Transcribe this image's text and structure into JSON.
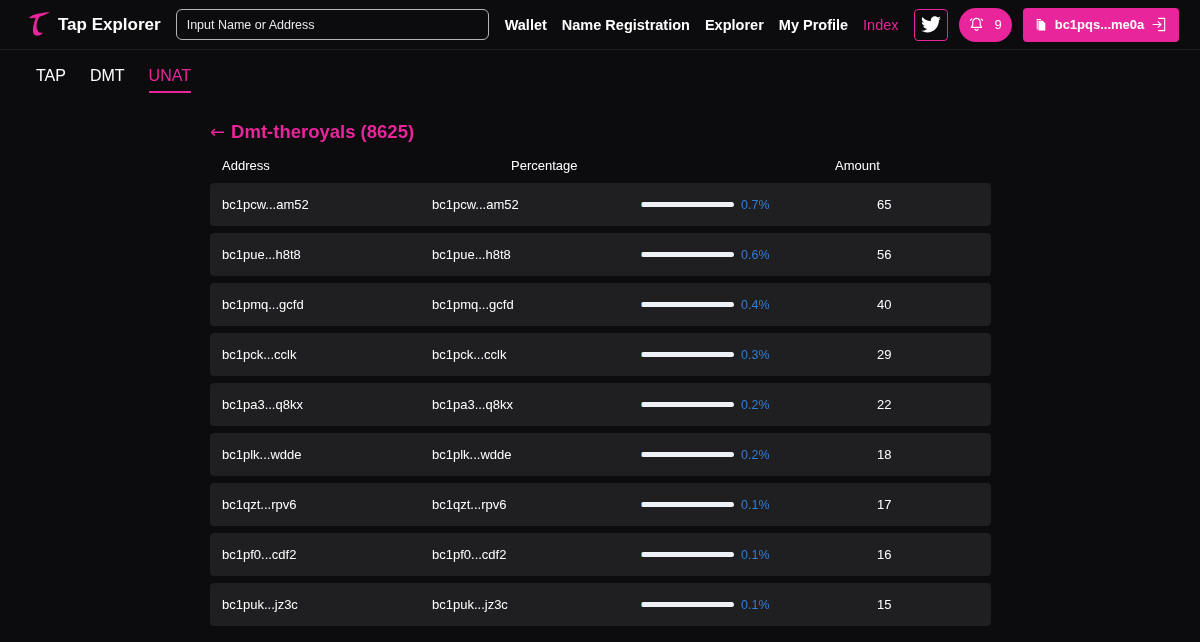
{
  "brand": {
    "name": "Tap Explorer"
  },
  "search": {
    "placeholder": "Input Name or Address"
  },
  "nav": [
    {
      "label": "Wallet",
      "selected": false
    },
    {
      "label": "Name Registration",
      "selected": false
    },
    {
      "label": "Explorer",
      "selected": false
    },
    {
      "label": "My Profile",
      "selected": false
    },
    {
      "label": "Index",
      "selected": true
    }
  ],
  "notifications": {
    "count": "9"
  },
  "wallet": {
    "address": "bc1pqs...me0a"
  },
  "tabs": [
    {
      "label": "TAP",
      "selected": false
    },
    {
      "label": "DMT",
      "selected": false
    },
    {
      "label": "UNAT",
      "selected": true
    }
  ],
  "page": {
    "back": "←",
    "title": "Dmt-theroyals (8625)"
  },
  "table": {
    "columns": [
      "Address",
      "Percentage",
      "Amount"
    ],
    "rows": [
      {
        "address": "bc1pcw...am52",
        "column_2": "bc1pcw...am52",
        "level": 0.007,
        "percentage": "0.7%",
        "amount": "65"
      },
      {
        "address": "bc1pue...h8t8",
        "column_2": "bc1pue...h8t8",
        "level": 0.006,
        "percentage": "0.6%",
        "amount": "56"
      },
      {
        "address": "bc1pmq...gcfd",
        "column_2": "bc1pmq...gcfd",
        "level": 0.004,
        "percentage": "0.4%",
        "amount": "40"
      },
      {
        "address": "bc1pck...cclk",
        "column_2": "bc1pck...cclk",
        "level": 0.003,
        "percentage": "0.3%",
        "amount": "29"
      },
      {
        "address": "bc1pa3...q8kx",
        "column_2": "bc1pa3...q8kx",
        "level": 0.002,
        "percentage": "0.2%",
        "amount": "22"
      },
      {
        "address": "bc1plk...wdde",
        "column_2": "bc1plk...wdde",
        "level": 0.002,
        "percentage": "0.2%",
        "amount": "18"
      },
      {
        "address": "bc1qzt...rpv6",
        "column_2": "bc1qzt...rpv6",
        "level": 0.001,
        "percentage": "0.1%",
        "amount": "17"
      },
      {
        "address": "bc1pf0...cdf2",
        "column_2": "bc1pf0...cdf2",
        "level": 0.001,
        "percentage": "0.1%",
        "amount": "16"
      },
      {
        "address": "bc1puk...jz3c",
        "column_2": "bc1puk...jz3c",
        "level": 0.001,
        "percentage": "0.1%",
        "amount": "15"
      }
    ]
  }
}
